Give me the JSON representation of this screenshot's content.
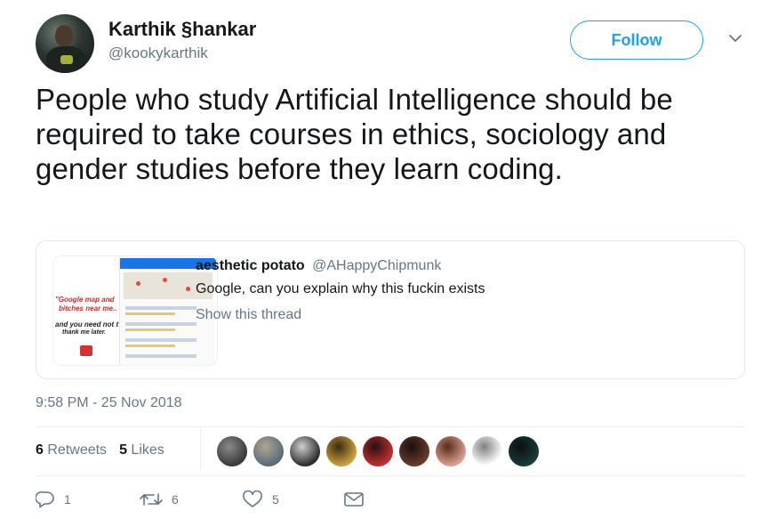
{
  "author": {
    "name": "Karthik §hankar",
    "handle": "@kookykarthik"
  },
  "follow_label": "Follow",
  "tweet": {
    "text": "People who study Artificial Intelligence should be required to take courses in ethics, sociology and gender studies before they learn coding."
  },
  "quoted_tweet": {
    "author_name": "aesthetic potato",
    "author_handle": "@AHappyChipmunk",
    "text": "Google, can you explain why this fuckin exists",
    "thread_link": "Show this thread",
    "thumbnail_text": {
      "line1": "\"Google map and",
      "line2": "bitches near me..",
      "line3": "and you need not t",
      "line4": "thank me later."
    }
  },
  "timestamp": "9:58 PM - 25 Nov 2018",
  "stats": {
    "retweets_count": "6",
    "retweets_label": "Retweets",
    "likes_count": "5",
    "likes_label": "Likes"
  },
  "likers": [
    {
      "colors": [
        "#3a3a3a",
        "#8a8a8a"
      ]
    },
    {
      "colors": [
        "#5b6b7a",
        "#b0a590"
      ]
    },
    {
      "colors": [
        "#2c2c2c",
        "#d0d0d0"
      ]
    },
    {
      "colors": [
        "#caa040",
        "#3a2a10"
      ]
    },
    {
      "colors": [
        "#c03030",
        "#2a1010"
      ]
    },
    {
      "colors": [
        "#6a3a2a",
        "#1a1010"
      ]
    },
    {
      "colors": [
        "#d8a090",
        "#5a2a1a"
      ]
    },
    {
      "colors": [
        "#ffffff",
        "#808080"
      ]
    },
    {
      "colors": [
        "#1a3a3a",
        "#0a1010"
      ]
    }
  ],
  "actions": {
    "replies": "1",
    "retweets": "6",
    "likes": "5"
  },
  "colors": {
    "accent": "#1da1f2",
    "muted": "#657786",
    "text": "#14171a",
    "border": "#e1e8ed"
  },
  "icons": {
    "reply": "reply-icon",
    "retweet": "retweet-icon",
    "like": "heart-icon",
    "dm": "envelope-icon",
    "more": "chevron-down-icon"
  }
}
